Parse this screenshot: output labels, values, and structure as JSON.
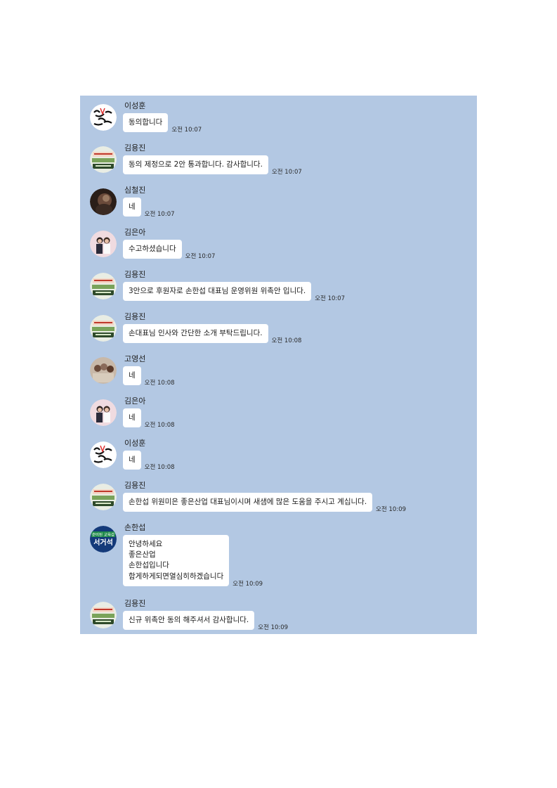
{
  "messages": [
    {
      "sender": "이성훈",
      "text": "동의합니다",
      "time": "오전 10:07",
      "avatar": "lettering-avatar"
    },
    {
      "sender": "김용진",
      "text": "동의 제정으로  2안 통과합니다. 감사합니다.",
      "time": "오전 10:07",
      "avatar": "banner-avatar"
    },
    {
      "sender": "심철진",
      "text": "네",
      "time": "오전 10:07",
      "avatar": "photo-avatar"
    },
    {
      "sender": "김은아",
      "text": "수고하셨습니다",
      "time": "오전 10:07",
      "avatar": "couple-avatar"
    },
    {
      "sender": "김용진",
      "text": "3안으로 후원자로 손한섭 대표님  운영위원 위촉안 입니다.",
      "time": "오전 10:07",
      "avatar": "banner-avatar"
    },
    {
      "sender": "김용진",
      "text": "손대표님 인사와 간단한 소개 부탁드립니다.",
      "time": "오전 10:08",
      "avatar": "banner-avatar"
    },
    {
      "sender": "고영선",
      "text": "네",
      "time": "오전 10:08",
      "avatar": "group-avatar"
    },
    {
      "sender": "김은아",
      "text": "네",
      "time": "오전 10:08",
      "avatar": "couple-avatar"
    },
    {
      "sender": "이성훈",
      "text": "네",
      "time": "오전 10:08",
      "avatar": "lettering-avatar"
    },
    {
      "sender": "김용진",
      "text": "손한섭 위원미은 좋은산업 대표님이시며 새샘에 많은 도움을 주시고 계십니다.",
      "time": "오전 10:09",
      "avatar": "banner-avatar"
    },
    {
      "sender": "손한섭",
      "text": "안녕하세요\n좋은산업\n손한섭입니다\n함게하게되면열심히하겠습니다",
      "time": "오전 10:09",
      "avatar": "seogeoseok-avatar",
      "avatar_text": "서거석",
      "avatar_subtext": "준비된 교육감"
    },
    {
      "sender": "김용진",
      "text": "신규 위촉안   동의 해주셔서 감사합니다.",
      "time": "오전 10:09",
      "avatar": "banner-avatar"
    }
  ],
  "colors": {
    "chat_background": "#b3c8e3",
    "bubble": "#ffffff",
    "page": "#ffffff"
  }
}
